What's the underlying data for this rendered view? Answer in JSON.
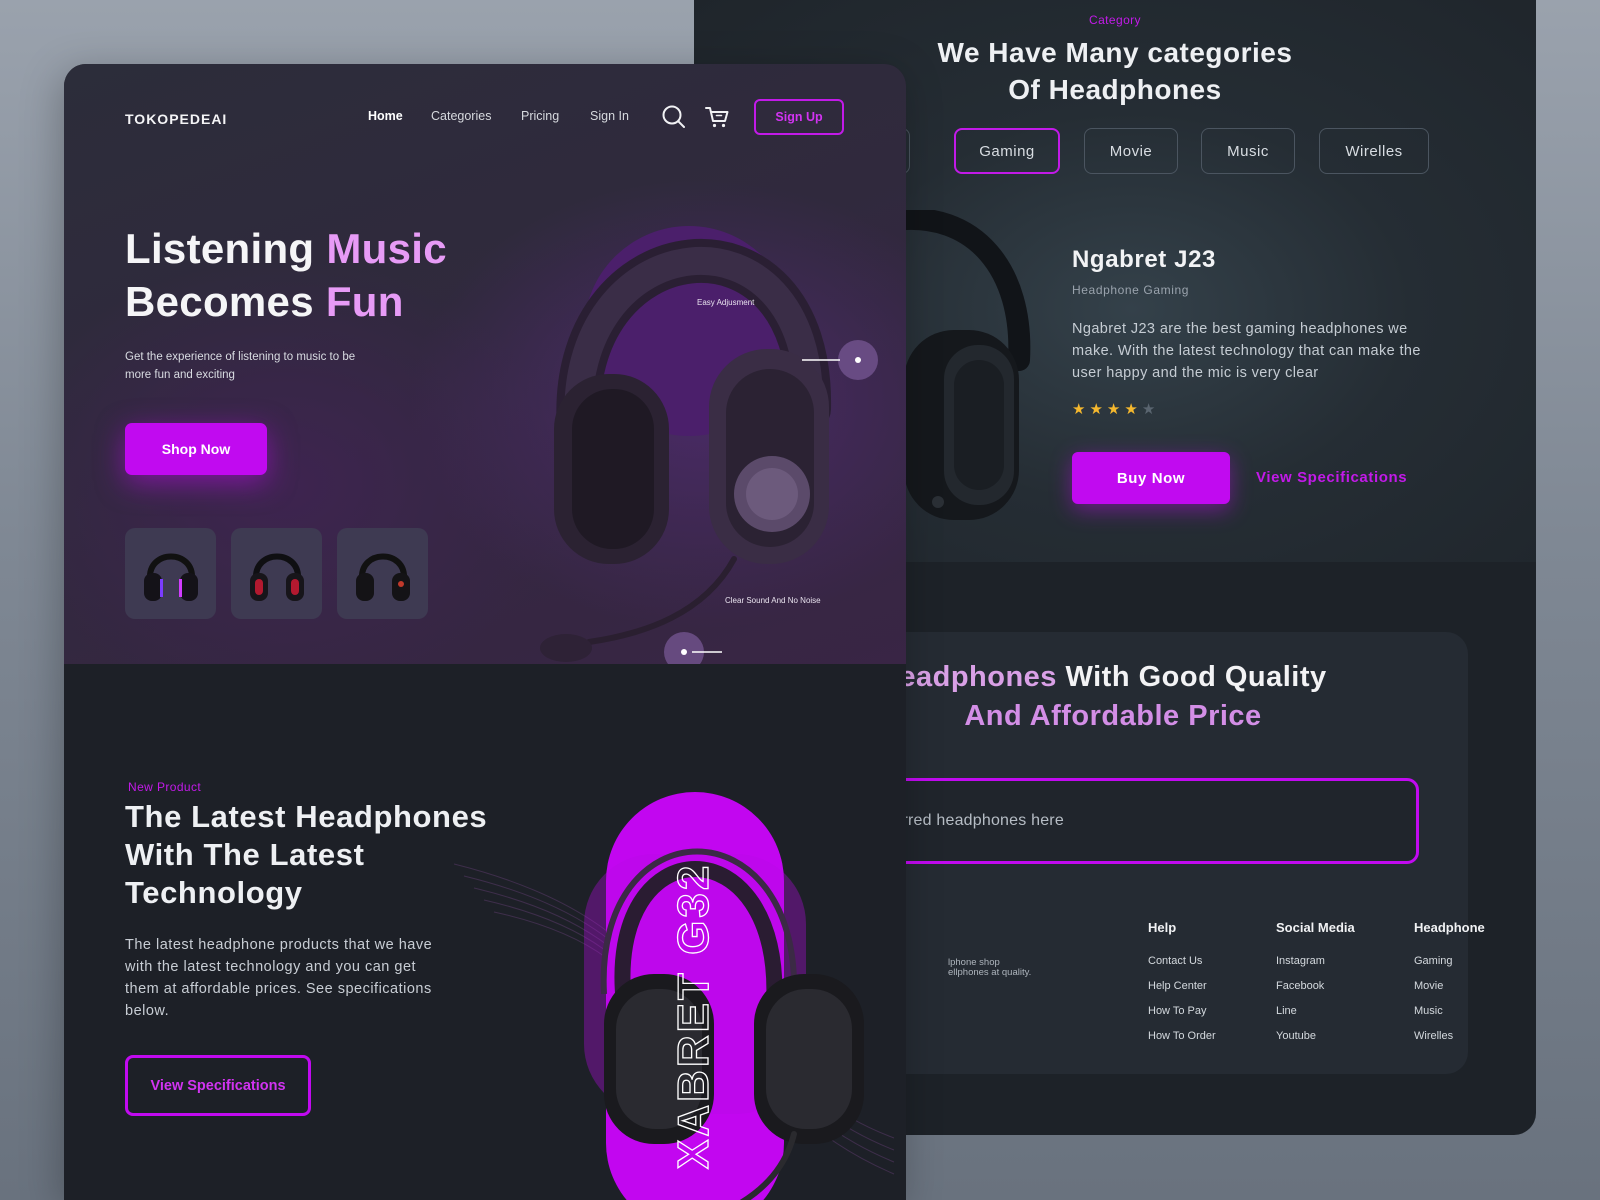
{
  "colors": {
    "accent": "#c10af0",
    "accent_text": "#c21ae8",
    "pink_heading": "#e79bf6",
    "bg_dark": "#1d2027"
  },
  "right_page": {
    "category": {
      "eyebrow": "Category",
      "title_line1": "We Have Many categories",
      "title_line2": "Of Headphones",
      "tabs": [
        {
          "label": "",
          "active": false
        },
        {
          "label": "Gaming",
          "active": true
        },
        {
          "label": "Movie",
          "active": false
        },
        {
          "label": "Music",
          "active": false
        },
        {
          "label": "Wirelles",
          "active": false
        }
      ]
    },
    "product": {
      "name": "Ngabret J23",
      "subtitle": "Headphone Gaming",
      "description": "Ngabret J23 are the best gaming headphones we make. With the latest technology that can make the user happy and the mic is very clear",
      "rating": 4,
      "rating_max": 5,
      "buy_label": "Buy Now",
      "specs_label": "View Specifications"
    },
    "panel": {
      "title_part_a": "eadphones",
      "title_part_b": " With Good Quality",
      "title_line2": "And Affordable Price",
      "search_placeholder": "preferred headphones here",
      "blurb": "lphone shop ellphones at quality."
    },
    "footer": {
      "help": {
        "heading": "Help",
        "links": [
          "Contact Us",
          "Help Center",
          "How To Pay",
          "How To Order"
        ]
      },
      "social": {
        "heading": "Social Media",
        "links": [
          "Instagram",
          "Facebook",
          "Line",
          "Youtube"
        ]
      },
      "headphone": {
        "heading": "Headphone",
        "links": [
          "Gaming",
          "Movie",
          "Music",
          "Wirelles"
        ]
      }
    }
  },
  "left_page": {
    "logo": "TOKOPEDEAI",
    "nav": [
      "Home",
      "Categories",
      "Pricing",
      "Sign In"
    ],
    "nav_active": "Home",
    "icons": [
      "search-icon",
      "cart-icon"
    ],
    "signup_label": "Sign Up",
    "hero": {
      "title_w1": "Listening ",
      "title_w2": "Music",
      "title_w3": "Becomes ",
      "title_w4": "Fun",
      "description": "Get the experience of listening to music to be more fun and exciting",
      "shop_label": "Shop Now",
      "callout_1": "Easy Adjusment",
      "callout_2": "Clear Sound And No Noise"
    },
    "new_product": {
      "eyebrow": "New Product",
      "title_line1": "The Latest Headphones",
      "title_line2": "With The Latest",
      "title_line3": "Technology",
      "description": "The latest headphone products that we have with the latest technology and you can get them at affordable prices. See specifications below.",
      "specs_label": "View Specifications",
      "model_text": "XABRET G32"
    }
  }
}
